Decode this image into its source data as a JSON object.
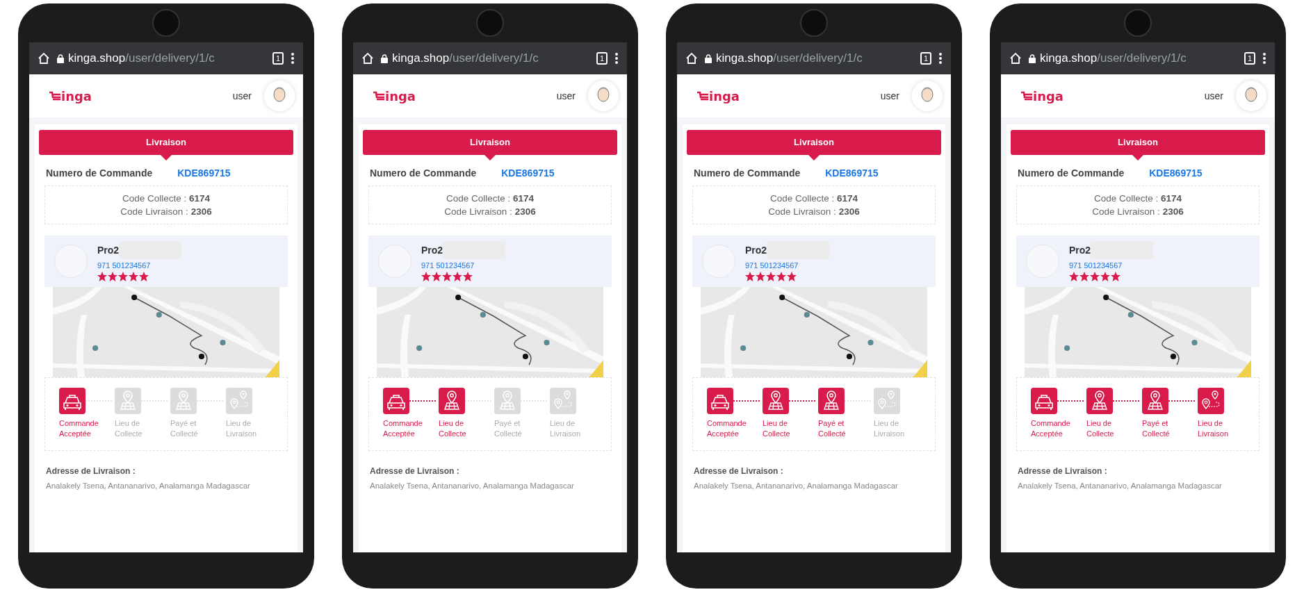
{
  "phones": [
    {
      "browser": {
        "url_host": "kinga.shop",
        "url_path": "/user/delivery/1/c",
        "tab_count": "1"
      },
      "header": {
        "logo_text": "inga",
        "user": "user"
      },
      "tab": "Livraison",
      "order": {
        "label": "Numero de Commande",
        "number": "KDE869715"
      },
      "codes": [
        {
          "label": "Code Collecte : ",
          "value": "6174"
        },
        {
          "label": "Code Livraison : ",
          "value": "2306"
        }
      ],
      "provider": {
        "name": "Pro2",
        "phone": "971 501234567",
        "stars": 5
      },
      "steps": [
        {
          "kind": "car",
          "label": "Commande Acceptée",
          "done": true
        },
        {
          "kind": "pickup",
          "label": "Lieu de Collecte",
          "done": false
        },
        {
          "kind": "paid",
          "label": "Payé et Collecté",
          "done": false
        },
        {
          "kind": "dropoff",
          "label": "Lieu de Livraison",
          "done": false
        }
      ],
      "address": {
        "label": "Adresse de Livraison :",
        "value": "Analakely Tsena, Antananarivo, Analamanga Madagascar"
      }
    },
    {
      "browser": {
        "url_host": "kinga.shop",
        "url_path": "/user/delivery/1/c",
        "tab_count": "1"
      },
      "header": {
        "logo_text": "inga",
        "user": "user"
      },
      "tab": "Livraison",
      "order": {
        "label": "Numero de Commande",
        "number": "KDE869715"
      },
      "codes": [
        {
          "label": "Code Collecte : ",
          "value": "6174"
        },
        {
          "label": "Code Livraison : ",
          "value": "2306"
        }
      ],
      "provider": {
        "name": "Pro2",
        "phone": "971 501234567",
        "stars": 5
      },
      "steps": [
        {
          "kind": "car",
          "label": "Commande Acceptée",
          "done": true
        },
        {
          "kind": "pickup",
          "label": "Lieu de Collecte",
          "done": true
        },
        {
          "kind": "paid",
          "label": "Payé et Collecté",
          "done": false
        },
        {
          "kind": "dropoff",
          "label": "Lieu de Livraison",
          "done": false
        }
      ],
      "address": {
        "label": "Adresse de Livraison :",
        "value": "Analakely Tsena, Antananarivo, Analamanga Madagascar"
      }
    },
    {
      "browser": {
        "url_host": "kinga.shop",
        "url_path": "/user/delivery/1/c",
        "tab_count": "1"
      },
      "header": {
        "logo_text": "inga",
        "user": "user"
      },
      "tab": "Livraison",
      "order": {
        "label": "Numero de Commande",
        "number": "KDE869715"
      },
      "codes": [
        {
          "label": "Code Collecte : ",
          "value": "6174"
        },
        {
          "label": "Code Livraison : ",
          "value": "2306"
        }
      ],
      "provider": {
        "name": "Pro2",
        "phone": "971 501234567",
        "stars": 5
      },
      "steps": [
        {
          "kind": "car",
          "label": "Commande Acceptée",
          "done": true
        },
        {
          "kind": "pickup",
          "label": "Lieu de Collecte",
          "done": true
        },
        {
          "kind": "paid",
          "label": "Payé et Collecté",
          "done": true
        },
        {
          "kind": "dropoff",
          "label": "Lieu de Livraison",
          "done": false
        }
      ],
      "address": {
        "label": "Adresse de Livraison :",
        "value": "Analakely Tsena, Antananarivo, Analamanga Madagascar"
      }
    },
    {
      "browser": {
        "url_host": "kinga.shop",
        "url_path": "/user/delivery/1/c",
        "tab_count": "1"
      },
      "header": {
        "logo_text": "inga",
        "user": "user"
      },
      "tab": "Livraison",
      "order": {
        "label": "Numero de Commande",
        "number": "KDE869715"
      },
      "codes": [
        {
          "label": "Code Collecte : ",
          "value": "6174"
        },
        {
          "label": "Code Livraison : ",
          "value": "2306"
        }
      ],
      "provider": {
        "name": "Pro2",
        "phone": "971 501234567",
        "stars": 5
      },
      "steps": [
        {
          "kind": "car",
          "label": "Commande Acceptée",
          "done": true
        },
        {
          "kind": "pickup",
          "label": "Lieu de Collecte",
          "done": true
        },
        {
          "kind": "paid",
          "label": "Payé et Collecté",
          "done": true
        },
        {
          "kind": "dropoff",
          "label": "Lieu de Livraison",
          "done": true
        }
      ],
      "address": {
        "label": "Adresse de Livraison :",
        "value": "Analakely Tsena, Antananarivo, Analamanga Madagascar"
      }
    }
  ]
}
